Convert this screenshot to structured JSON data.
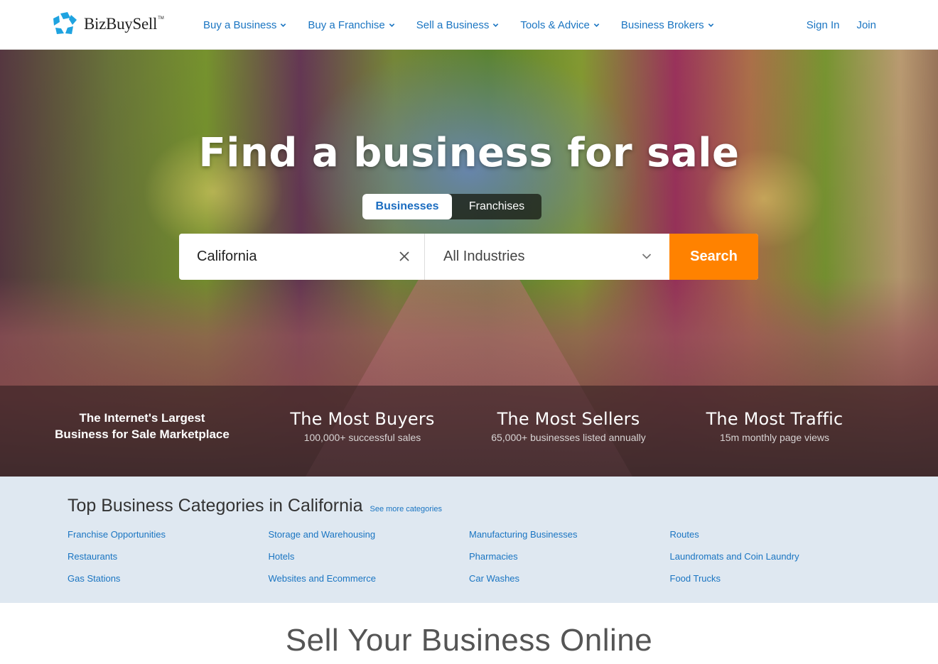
{
  "header": {
    "brand": "BizBuySell",
    "brand_tm": "TM",
    "brand_color": "#1fa3e0",
    "nav": [
      {
        "label": "Buy a Business",
        "icon": "chevron-down-icon"
      },
      {
        "label": "Buy a Franchise",
        "icon": "chevron-down-icon"
      },
      {
        "label": "Sell a Business",
        "icon": "chevron-down-icon"
      },
      {
        "label": "Tools & Advice",
        "icon": "chevron-down-icon"
      },
      {
        "label": "Business Brokers",
        "icon": "chevron-down-icon"
      }
    ],
    "sign_in": "Sign In",
    "join": "Join",
    "link_color": "#1a75c2"
  },
  "hero": {
    "title": "Find a business for sale",
    "tabs": [
      {
        "label": "Businesses",
        "active": true
      },
      {
        "label": "Franchises",
        "active": false
      }
    ],
    "search": {
      "location_value": "California",
      "clear_icon": "close-icon",
      "industry_selected": "All Industries",
      "industry_icon": "chevron-down-icon",
      "button_label": "Search",
      "button_color": "#ff8200"
    },
    "stats": {
      "intro_line1": "The Internet's Largest",
      "intro_line2": "Business for Sale Marketplace",
      "items": [
        {
          "title": "The Most Buyers",
          "subtitle": "100,000+ successful sales"
        },
        {
          "title": "The Most Sellers",
          "subtitle": "65,000+ businesses listed annually"
        },
        {
          "title": "The Most Traffic",
          "subtitle": "15m monthly page views"
        }
      ]
    }
  },
  "categories": {
    "title": "Top Business Categories in California",
    "see_more": "See more categories",
    "background": "#dfe8f1",
    "items": [
      "Franchise Opportunities",
      "Storage and Warehousing",
      "Manufacturing Businesses",
      "Routes",
      "Restaurants",
      "Hotels",
      "Pharmacies",
      "Laundromats and Coin Laundry",
      "Gas Stations",
      "Websites and Ecommerce",
      "Car Washes",
      "Food Trucks"
    ]
  },
  "sell": {
    "title": "Sell Your Business Online"
  }
}
